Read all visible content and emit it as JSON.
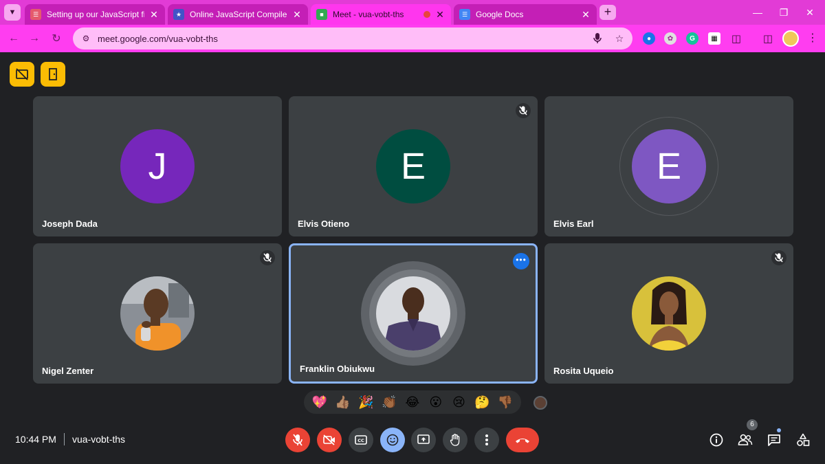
{
  "browser": {
    "tabs": [
      {
        "label": "Setting up our JavaScript file",
        "active": false
      },
      {
        "label": "Online JavaScript Compiler (Edi",
        "active": false
      },
      {
        "label": "Meet - vua-vobt-ths",
        "active": true
      },
      {
        "label": "Google Docs",
        "active": false
      }
    ],
    "url": "meet.google.com/vua-vobt-ths",
    "accent_color": "#ff3df0"
  },
  "meet": {
    "participants": [
      {
        "name": "Joseph Dada",
        "initial": "J",
        "avatar_color": "#7627bb",
        "muted": false
      },
      {
        "name": "Elvis Otieno",
        "initial": "E",
        "avatar_color": "#004d40",
        "muted": true
      },
      {
        "name": "Elvis Earl",
        "initial": "E",
        "avatar_color": "#7e57c2",
        "muted": false
      },
      {
        "name": "Nigel Zenter",
        "initial": "",
        "avatar_color": "#5d4037",
        "muted": true
      },
      {
        "name": "Franklin Obiukwu",
        "initial": "",
        "avatar_color": "#4a3f6b",
        "muted": false
      },
      {
        "name": "Rosita Uqueio",
        "initial": "",
        "avatar_color": "#d8c13b",
        "muted": true
      }
    ],
    "reactions": [
      "💖",
      "👍🏽",
      "🎉",
      "👏🏾",
      "😂",
      "😮",
      "😢",
      "🤔",
      "👎🏾"
    ],
    "time": "10:44 PM",
    "meeting_code": "vua-vobt-ths",
    "people_count": "6"
  }
}
